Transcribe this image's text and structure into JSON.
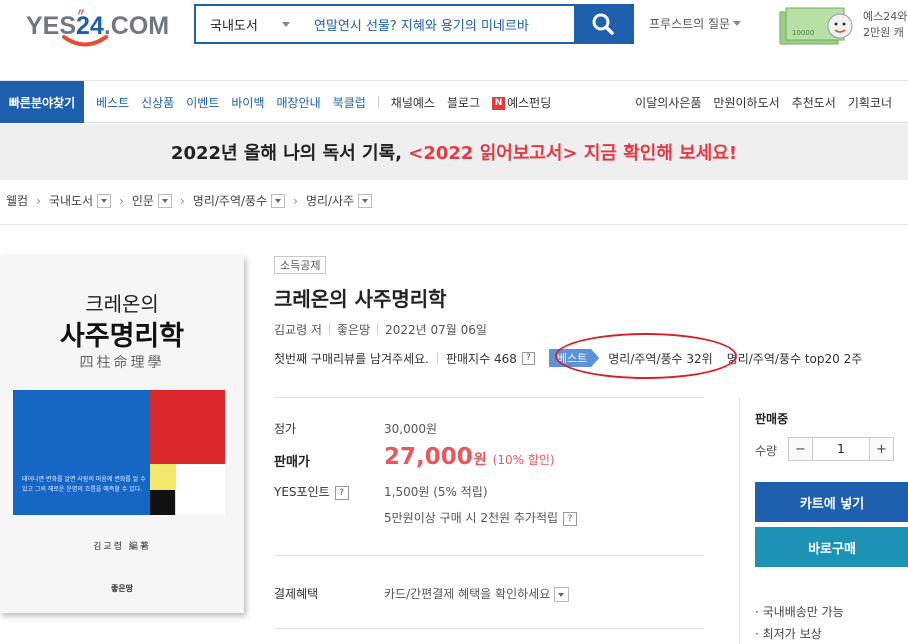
{
  "header": {
    "logo": {
      "text_a": "YES",
      "text_b": "24",
      "text_c": ".COM",
      "accent": "#e84a32",
      "brand": "#1e5fae"
    },
    "search": {
      "category": "국내도서",
      "query": "연말연시 선물? 지혜와 용기의 미네르바"
    },
    "faq_label": "프루스트의 질문",
    "promo": {
      "line1": "예스24와",
      "line2": "2만원 캐",
      "image_caption": "10000"
    }
  },
  "nav": {
    "quick_label": "빠른분야찾기",
    "left_items": [
      "베스트",
      "신상품",
      "이벤트",
      "바이백",
      "매장안내",
      "북클럽"
    ],
    "dark_items": [
      "채널예스",
      "블로그",
      "예스펀딩"
    ],
    "n_badge": "N",
    "right_items": [
      "이달의사은품",
      "만원이하도서",
      "추천도서",
      "기획코너"
    ]
  },
  "banner": {
    "prefix": "2022년 올해 나의 독서 기록, ",
    "highlight": "<2022 읽어보고서> 지금 확인해 보세요!"
  },
  "breadcrumb": {
    "items": [
      "웰컴",
      "국내도서",
      "인문",
      "명리/주역/풍수",
      "명리/사주"
    ]
  },
  "cover": {
    "line1": "크레온의",
    "line2": "사주명리학",
    "hanja": "四柱命理學",
    "blurb": "태어나면 변화를 알면 사람의 마음에 변화를 알 수 있고 그의 해로운 운명의 흐름을 예측할 수 있다.",
    "author": "김교령 編著",
    "publisher": "좋은땅"
  },
  "book": {
    "tag": "소득공제",
    "title": "크레온의 사주명리학",
    "author": "김교령 저",
    "publisher": "좋은땅",
    "date": "2022년 07월 06일",
    "review_prompt": "첫번째 구매리뷰를 남겨주세요.",
    "sales_index": "판매지수 468",
    "help": "?",
    "best_badge": "베스트",
    "rank": "명리/주역/풍수 32위",
    "top20": "명리/주역/풍수 top20 2주"
  },
  "price": {
    "list_label": "정가",
    "list_value": "30,000원",
    "sale_label": "판매가",
    "sale_value": "27,000",
    "sale_unit": "원",
    "discount": "(10% 할인)",
    "points_label": "YES포인트",
    "points_value": "1,500원 (5% 적립)",
    "points_extra": "5만원이상 구매 시 2천원 추가적립",
    "payment_label": "결제혜택",
    "payment_value": "카드/간편결제 혜택을 확인하세요"
  },
  "panel": {
    "status": "판매중",
    "qty_label": "수량",
    "minus": "−",
    "qty": "1",
    "plus": "+",
    "cart": "카트에 넣기",
    "buy": "바로구매",
    "note1": "· 국내배송만 가능",
    "note2": "· 최저가 보상"
  },
  "colors": {
    "brand_blue": "#1e5fae",
    "sale_red": "#e8585a",
    "annotation_red": "#d41f26",
    "buy_teal": "#1c93b4"
  }
}
